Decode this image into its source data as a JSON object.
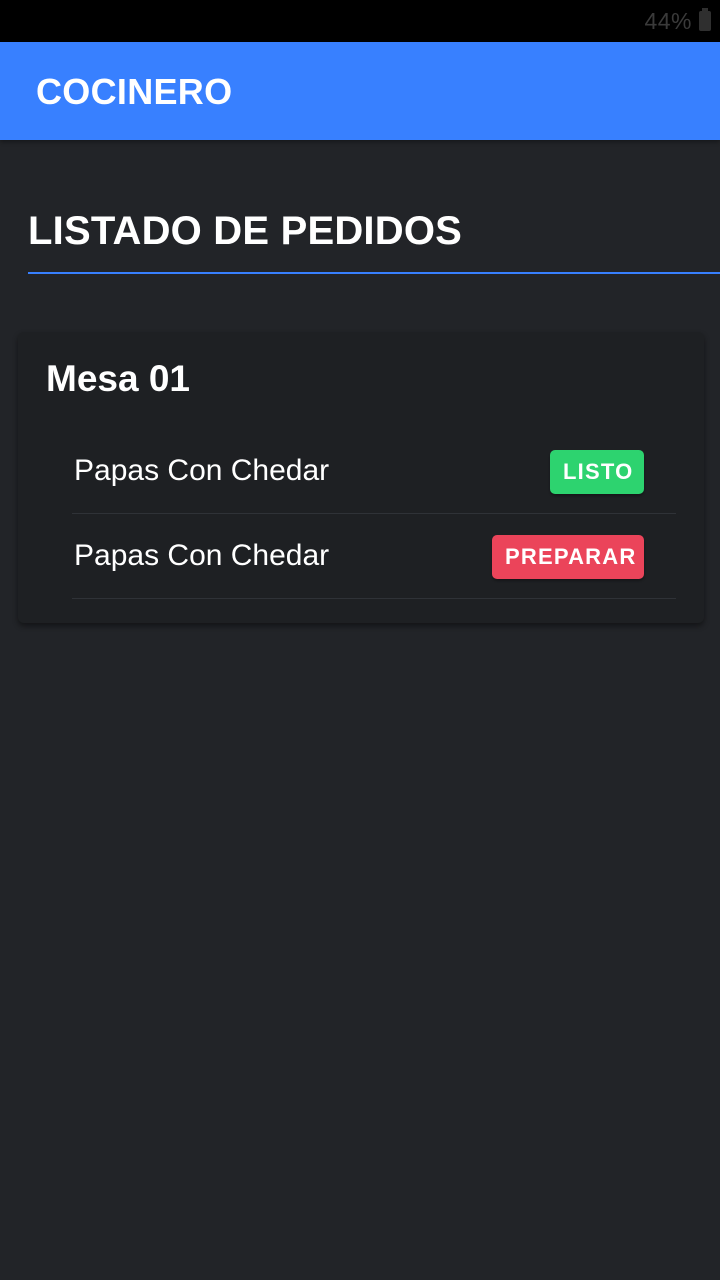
{
  "status_bar": {
    "battery_percent": "44%",
    "battery_icon": "battery-icon"
  },
  "toolbar": {
    "title": "COCINERO",
    "color": "#3880ff"
  },
  "section": {
    "title": "LISTADO DE PEDIDOS"
  },
  "tables": [
    {
      "name": "Mesa 01",
      "items": [
        {
          "label": "Papas Con Chedar",
          "action": "LISTO",
          "action_color": "#2dd36f"
        },
        {
          "label": "Papas Con Chedar",
          "action": "PREPARAR",
          "action_color": "#eb445a"
        }
      ]
    }
  ],
  "colors": {
    "background": "#222428",
    "card": "#1e2023",
    "primary": "#3880ff",
    "success": "#2dd36f",
    "danger": "#eb445a"
  }
}
